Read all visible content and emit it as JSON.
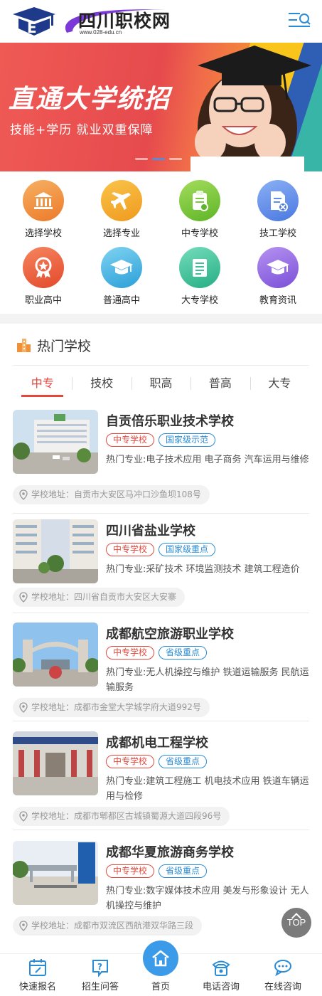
{
  "header": {
    "site_name": "四川职校网",
    "site_url": "www.028-edu.cn",
    "menu_icon": "menu-search-icon"
  },
  "banner": {
    "headline": "直通大学统招",
    "subline": "技能+学历   就业双重保障",
    "slide_count": 3,
    "active_slide": 2
  },
  "categories": [
    {
      "label": "选择学校",
      "icon": "bank-icon",
      "color": "#f0913a"
    },
    {
      "label": "选择专业",
      "icon": "airplane-icon",
      "color": "#f3a92c"
    },
    {
      "label": "中专学校",
      "icon": "clipboard-icon",
      "color": "#7cc83d"
    },
    {
      "label": "技工学校",
      "icon": "document-tools-icon",
      "color": "#5d8ee8"
    },
    {
      "label": "职业高中",
      "icon": "award-icon",
      "color": "#ee6345"
    },
    {
      "label": "普通高中",
      "icon": "graduation-cap-icon",
      "color": "#3cb3df"
    },
    {
      "label": "大专学校",
      "icon": "book-icon",
      "color": "#3dc09a"
    },
    {
      "label": "教育资讯",
      "icon": "mortarboard-icon",
      "color": "#9467e0"
    }
  ],
  "hot": {
    "title": "热门学校",
    "tabs": [
      "中专",
      "技校",
      "职高",
      "普高",
      "大专"
    ],
    "active_tab": 0
  },
  "schools": [
    {
      "name": "自贡倍乐职业技术学校",
      "tags": [
        {
          "text": "中专学校",
          "style": "red"
        },
        {
          "text": "国家级示范",
          "style": "blue"
        }
      ],
      "major": "热门专业:电子技术应用  电子商务  汽车运用与维修",
      "address": "学校地址：自贡市大安区马冲口沙鱼坝108号"
    },
    {
      "name": "四川省盐业学校",
      "tags": [
        {
          "text": "中专学校",
          "style": "red"
        },
        {
          "text": "国家级重点",
          "style": "blue"
        }
      ],
      "major": "热门专业:采矿技术  环境监测技术  建筑工程造价",
      "address": "学校地址：四川省自贡市大安区大安寨"
    },
    {
      "name": "成都航空旅游职业学校",
      "tags": [
        {
          "text": "中专学校",
          "style": "red"
        },
        {
          "text": "省级重点",
          "style": "blue"
        }
      ],
      "major": "热门专业:无人机操控与维护  铁道运输服务  民航运输服务",
      "address": "学校地址：成都市金堂大学城学府大道992号"
    },
    {
      "name": "成都机电工程学校",
      "tags": [
        {
          "text": "中专学校",
          "style": "red"
        },
        {
          "text": "省级重点",
          "style": "blue"
        }
      ],
      "major": "热门专业:建筑工程施工  机电技术应用  铁道车辆运用与检修",
      "address": "学校地址：成都市郫都区古城镇蜀源大道四段96号"
    },
    {
      "name": "成都华夏旅游商务学校",
      "tags": [
        {
          "text": "中专学校",
          "style": "red"
        },
        {
          "text": "省级重点",
          "style": "blue"
        }
      ],
      "major": "热门专业:数字媒体技术应用  美发与形象设计  无人机操控与维护",
      "address": "学校地址：成都市双流区西航港双华路三段"
    }
  ],
  "top_button": "TOP",
  "bottom_nav": [
    {
      "label": "快速报名",
      "icon": "calendar-edit-icon"
    },
    {
      "label": "招生问答",
      "icon": "question-chat-icon"
    },
    {
      "label": "首页",
      "icon": "home-icon"
    },
    {
      "label": "电话咨询",
      "icon": "telephone-icon"
    },
    {
      "label": "在线咨询",
      "icon": "chat-bubbles-icon"
    }
  ]
}
